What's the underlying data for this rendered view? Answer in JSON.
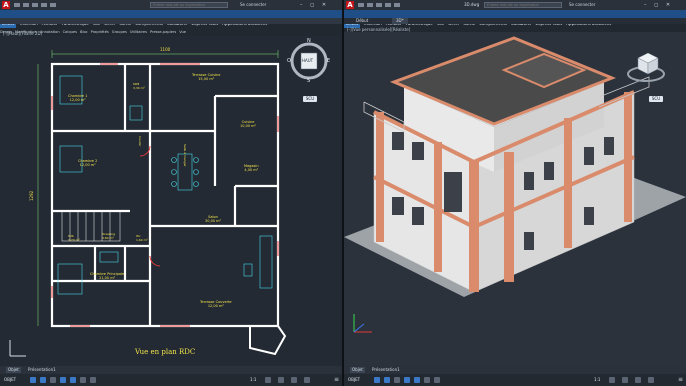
{
  "left": {
    "qa_icons": [
      "new-icon",
      "open-icon",
      "save-icon",
      "undo-icon",
      "redo-icon"
    ],
    "search_placeholder": "Entrez mot-clé ou expression",
    "signin": "Se connecter",
    "window_controls": "– ◻ ✕",
    "ribbon": [
      "Début",
      "Insertion",
      "Annoter",
      "Paramétrique",
      "Vue",
      "Gérer",
      "Sortie",
      "Compléments",
      "Collaborer",
      "Express Tools",
      "Applications associées"
    ],
    "panels": [
      "Dessin",
      "Modification",
      "Annotation",
      "Calques",
      "Bloc",
      "Propriétés",
      "Groupes",
      "Utilitaires",
      "Presse-papiers",
      "Vue"
    ],
    "view_label": "[-][Haut][Filaire 2D]",
    "drawing": {
      "dim_top": "1100",
      "dim_left": "1292",
      "rooms": [
        {
          "id": "ch1",
          "label": "Chambre 1",
          "area": "12,00 m²"
        },
        {
          "id": "sdb1",
          "label": "SDB",
          "area": "3,30 m²"
        },
        {
          "id": "terrasse",
          "label": "Terrasse Cuisine",
          "area": "15,00 m²"
        },
        {
          "id": "cuisine",
          "label": "Cuisine",
          "area": "10,00 m²"
        },
        {
          "id": "salle",
          "label": "Salle à manger",
          "area": "19,00 m²"
        },
        {
          "id": "couloir",
          "label": "Couloir",
          "area": "8,00 m²"
        },
        {
          "id": "ch2",
          "label": "Chambre 2",
          "area": "12,00 m²"
        },
        {
          "id": "magasin",
          "label": "Magasin",
          "area": "4,00 m²"
        },
        {
          "id": "salon",
          "label": "Salon",
          "area": "30,00 m²"
        },
        {
          "id": "sdb2",
          "label": "Sdb",
          "area": "3,70 m²"
        },
        {
          "id": "dressing",
          "label": "Dressing",
          "area": "3,80 m²"
        },
        {
          "id": "wc",
          "label": "Wc",
          "area": "1,60 m²"
        },
        {
          "id": "chp",
          "label": "Chambre Principale",
          "area": "21,00 m²"
        },
        {
          "id": "terrasse2",
          "label": "Terrasse Couverte",
          "area": "12,00 m²"
        }
      ],
      "caption": "Vue en plan RDC"
    },
    "viewcube": {
      "top": "N",
      "left": "O",
      "right": "E",
      "bottom": "S",
      "face": "HAUT",
      "wcs": "SCU"
    },
    "status_tabs": [
      "Objet",
      "Présentation1",
      "Présentation2"
    ],
    "toolbar_label": "OBJET",
    "toolbar_scale": "1:1"
  },
  "right": {
    "qa_icons": [
      "new-icon",
      "open-icon",
      "save-icon",
      "undo-icon",
      "redo-icon"
    ],
    "file_title": "3D.dwg",
    "search_placeholder": "Entrez mot-clé ou expression",
    "signin": "Se connecter",
    "window_controls": "– ◻ ✕",
    "ribbon": [
      "Début",
      "Insertion",
      "Annoter",
      "Paramétrique",
      "Vue",
      "Gérer",
      "Sortie",
      "Compléments",
      "Collaborer",
      "Express Tools",
      "Applications associées"
    ],
    "doc_tabs": [
      "Début",
      "3D*"
    ],
    "view_label": "[-][Vue personnalisée][Réaliste]",
    "viewcube": {
      "wcs": "SCU"
    },
    "status_tabs": [
      "Objet",
      "Présentation1",
      "Présentation2"
    ],
    "toolbar_label": "OBJET",
    "toolbar_scale": "1:1"
  },
  "colors": {
    "accent": "#1f4f86",
    "walls": "#ffffff",
    "dims": "#7fe87f",
    "text": "#f2e24b",
    "facade": "#d98b6b",
    "roof": "#4a4a4a"
  }
}
